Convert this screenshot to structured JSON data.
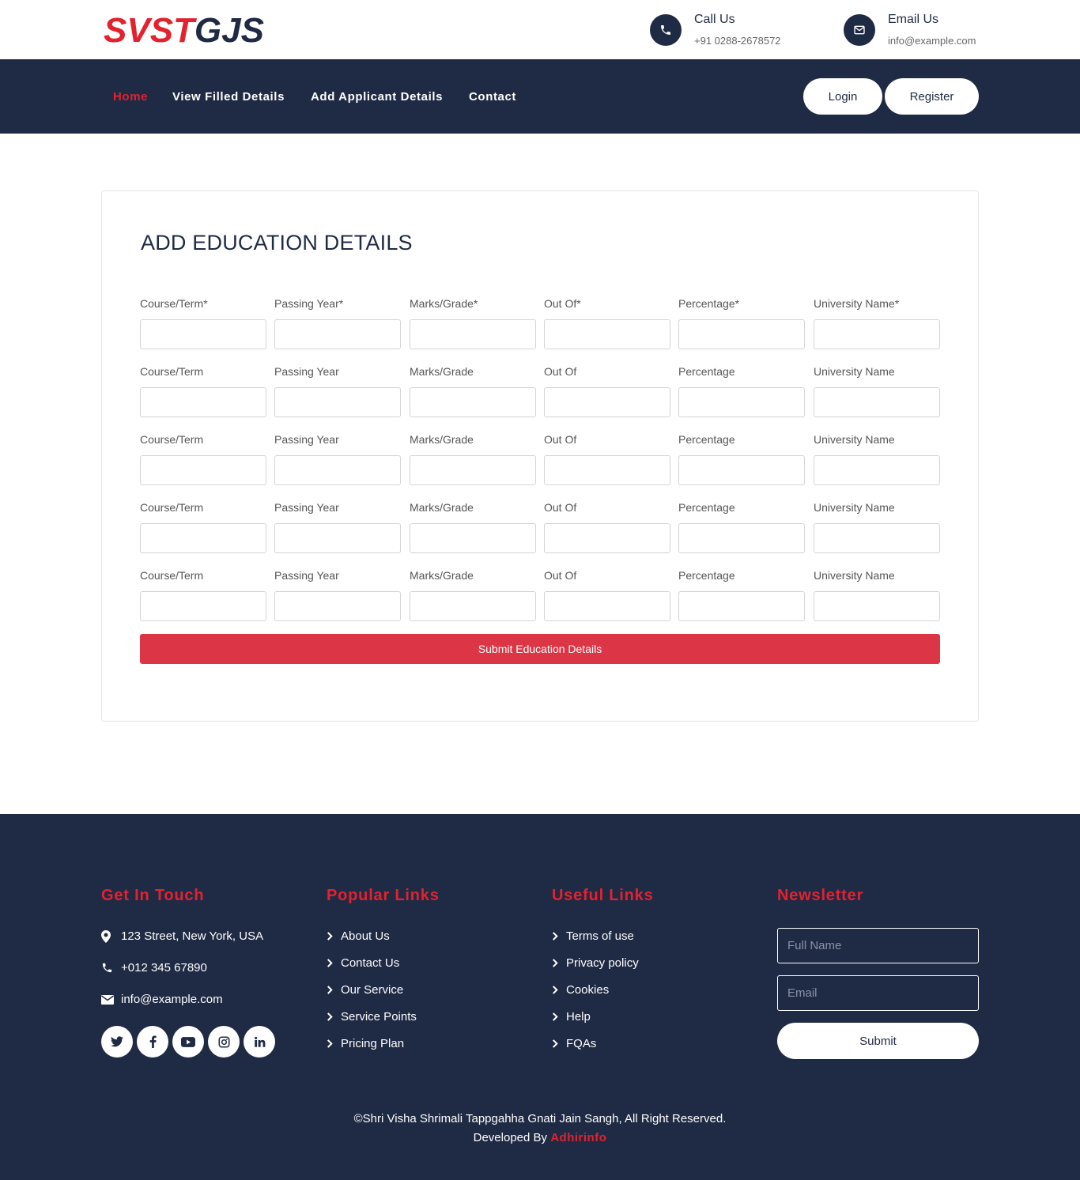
{
  "header": {
    "logo_part1": "SVST",
    "logo_part2": "GJS",
    "call_title": "Call Us",
    "call_value": "+91 0288-2678572",
    "email_title": "Email Us",
    "email_value": "info@example.com"
  },
  "nav": {
    "links": [
      "Home",
      "View Filled Details",
      "Add Applicant Details",
      "Contact"
    ],
    "login": "Login",
    "register": "Register"
  },
  "form": {
    "title": "ADD EDUCATION DETAILS",
    "rows": [
      [
        "Course/Term*",
        "Passing Year*",
        "Marks/Grade*",
        "Out Of*",
        "Percentage*",
        "University Name*"
      ],
      [
        "Course/Term",
        "Passing Year",
        "Marks/Grade",
        "Out Of",
        "Percentage",
        "University Name"
      ],
      [
        "Course/Term",
        "Passing Year",
        "Marks/Grade",
        "Out Of",
        "Percentage",
        "University Name"
      ],
      [
        "Course/Term",
        "Passing Year",
        "Marks/Grade",
        "Out Of",
        "Percentage",
        "University Name"
      ],
      [
        "Course/Term",
        "Passing Year",
        "Marks/Grade",
        "Out Of",
        "Percentage",
        "University Name"
      ]
    ],
    "submit": "Submit Education Details"
  },
  "footer": {
    "get_in_touch": {
      "heading": "Get In Touch",
      "address": "123 Street, New York, USA",
      "phone": "+012 345 67890",
      "email": "info@example.com"
    },
    "social_icons": [
      "twitter-icon",
      "facebook-icon",
      "youtube-icon",
      "instagram-icon",
      "linkedin-icon"
    ],
    "popular_links": {
      "heading": "Popular Links",
      "items": [
        "About Us",
        "Contact Us",
        "Our Service",
        "Service Points",
        "Pricing Plan"
      ]
    },
    "useful_links": {
      "heading": "Useful Links",
      "items": [
        "Terms of use",
        "Privacy policy",
        "Cookies",
        "Help",
        "FQAs"
      ]
    },
    "newsletter": {
      "heading": "Newsletter",
      "name_placeholder": "Full Name",
      "email_placeholder": "Email",
      "submit": "Submit"
    },
    "copyright": "©Shri Visha Shrimali Tappgahha Gnati Jain Sangh, All Right Reserved.",
    "developed_by": "Developed By",
    "developer": "Adhirinfo"
  },
  "colors": {
    "navy": "#1f2a44",
    "accent_red": "#e3222f",
    "button_red": "#dc3545"
  }
}
